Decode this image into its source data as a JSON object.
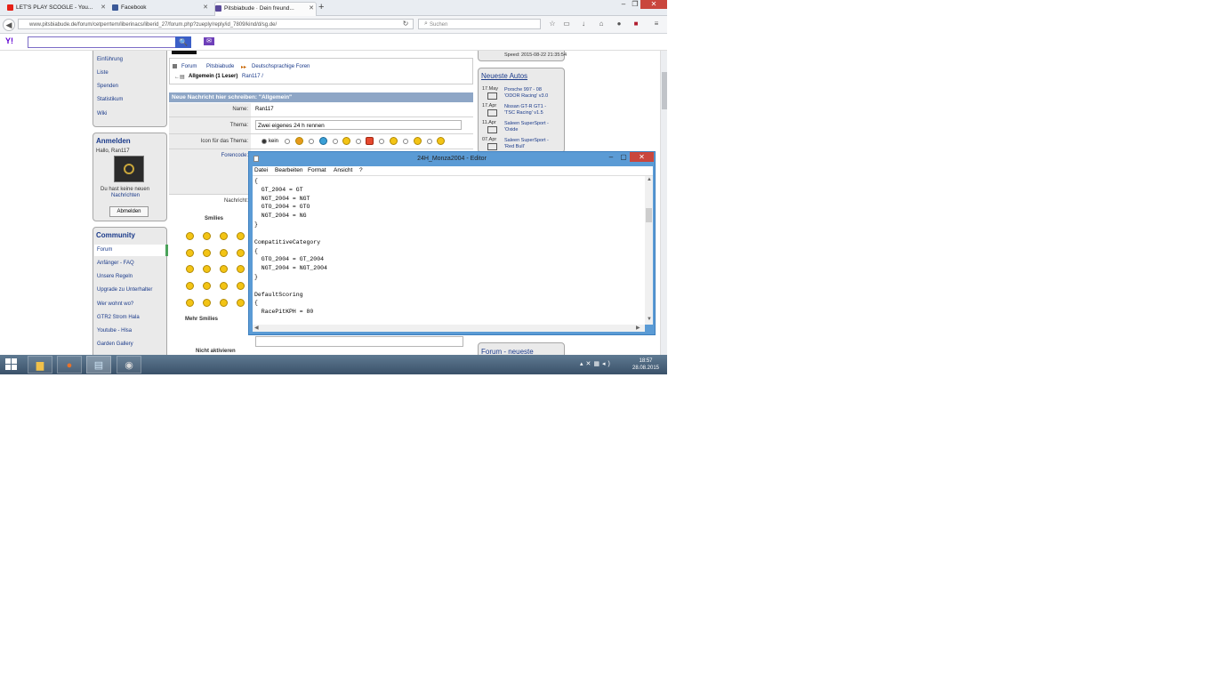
{
  "browser": {
    "tabs": [
      {
        "label": "LET'S PLAY SCOGLE - You...",
        "color": "#e62117"
      },
      {
        "label": "Facebook",
        "color": "#3b5998"
      },
      {
        "label": "Pitsbiabude · Dein freund...",
        "color": "#5a4a9a"
      }
    ],
    "url": "www.pitsbiabude.de/forum/cetperrtem/liberinacs/liberid_27/forum.php?zueply/reply/id_7809/kind/d/sg.de/",
    "search_placeholder": "Suchen",
    "new_tab_label": "+"
  },
  "yahoo": {
    "logo": "Y!",
    "search_label": "🔍"
  },
  "sidebar": {
    "top_links": [
      "Einführung",
      "Liste",
      "Spenden",
      "Statistikum",
      "Wiki"
    ],
    "login": {
      "title": "Anmelden",
      "greeting": "Hallo, Ran117",
      "messages_line": "Du hast keine neuen",
      "messages_line2": "Nachrichten",
      "logout_button": "Abmelden"
    },
    "community": {
      "title": "Community",
      "links": [
        "Forum",
        "Anfänger - FAQ",
        "Unsere Regeln",
        "Upgrade zu Unterhalter",
        "Wer wohnt wo?",
        "GTR2 Strom Hala",
        "Youtube - Hlsa",
        "Garden Gallery"
      ]
    }
  },
  "forum": {
    "breadcrumb": [
      "Forum",
      "Pitsbiabude",
      "Deutschsprachige Foren"
    ],
    "subforum": "Allgemein (1 Leser)",
    "subforum_extra": "Ran117 /",
    "header": "Neue Nachricht hier schreiben: \"Allgemein\"",
    "name_label": "Name:",
    "name_value": "Ran117",
    "subject_label": "Thema:",
    "subject_value": "Zwei eigenes 24 h rennen",
    "icon_label": "Icon für das Thema:",
    "icon_none": "kein",
    "forum_code_label": "Forencode:",
    "message_label": "Nachricht:",
    "smilies_label": "Smilies",
    "more_smilies": "Mehr Smilies",
    "bottom_label": "Nicht aktivieren"
  },
  "right_col": {
    "top_date": "Speed: 2015-08-22 21:35:54",
    "title": "Neueste Autos",
    "items": [
      {
        "date": "17.May",
        "name": "Porsche 997 - 08",
        "sub": "'ODOR Racing' v3.0"
      },
      {
        "date": "17.Apr",
        "name": "Nissan GT-R GT1 -",
        "sub": "'TSC Racing' v1.5"
      },
      {
        "date": "11.Apr",
        "name": "Saleen SuperSport -",
        "sub": "'Oxide"
      },
      {
        "date": "07.Apr",
        "name": "Saleen SuperSport -",
        "sub": "'Red Bull'"
      }
    ],
    "bottom": "Forum - neueste"
  },
  "notepad": {
    "title": "24H_Monza2004 - Editor",
    "menu": [
      "Datei",
      "Bearbeiten",
      "Format",
      "Ansicht",
      "?"
    ],
    "lines": [
      "{",
      "  GT_2004 = GT",
      "  NGT_2004 = NGT",
      "  GTO_2004 = GTO",
      "  NGT_2004 = NG",
      "}",
      "",
      "CompatitiveCategory",
      "{",
      "  GTO_2004 = GT_2004",
      "  NGT_2004 = NGT_2004",
      "}",
      "",
      "DefaultScoring",
      "{",
      "  RacePitKPH = 80"
    ]
  },
  "taskbar": {
    "time": "18:57",
    "date": "28.08.2015"
  }
}
